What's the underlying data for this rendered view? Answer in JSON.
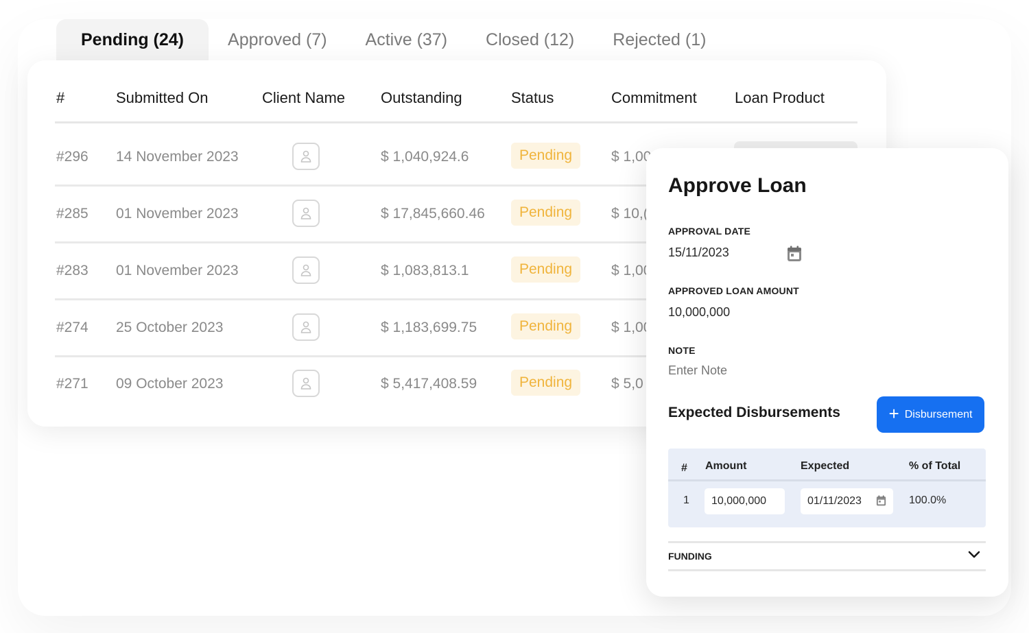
{
  "tabs": [
    {
      "label": "Pending (24)",
      "active": true
    },
    {
      "label": "Approved (7)",
      "active": false
    },
    {
      "label": "Active (37)",
      "active": false
    },
    {
      "label": "Closed (12)",
      "active": false
    },
    {
      "label": "Rejected (1)",
      "active": false
    }
  ],
  "table": {
    "headers": {
      "id": "#",
      "submitted": "Submitted On",
      "client": "Client Name",
      "outstanding": "Outstanding",
      "status": "Status",
      "commitment": "Commitment",
      "product": "Loan Product"
    },
    "rows": [
      {
        "id": "#296",
        "submitted": "14 November 2023",
        "outstanding": "$ 1,040,924.6",
        "status": "Pending",
        "commitment": "$ 1,00"
      },
      {
        "id": "#285",
        "submitted": "01 November 2023",
        "outstanding": "$ 17,845,660.46",
        "status": "Pending",
        "commitment": "$ 10,("
      },
      {
        "id": "#283",
        "submitted": "01 November 2023",
        "outstanding": "$ 1,083,813.1",
        "status": "Pending",
        "commitment": "$ 1,00"
      },
      {
        "id": "#274",
        "submitted": "25 October 2023",
        "outstanding": "$ 1,183,699.75",
        "status": "Pending",
        "commitment": "$ 1,00"
      },
      {
        "id": "#271",
        "submitted": "09 October 2023",
        "outstanding": "$ 5,417,408.59",
        "status": "Pending",
        "commitment": "$ 5,0"
      }
    ]
  },
  "approve_panel": {
    "title": "Approve Loan",
    "approval_date_label": "APPROVAL DATE",
    "approval_date_value": "15/11/2023",
    "amount_label": "APPROVED LOAN AMOUNT",
    "amount_value": "10,000,000",
    "note_label": "NOTE",
    "note_placeholder": "Enter Note",
    "disbursements_title": "Expected Disbursements",
    "add_button_label": "Disbursement",
    "disb_headers": {
      "num": "#",
      "amount": "Amount",
      "expected": "Expected",
      "pct": "% of Total"
    },
    "disb_rows": [
      {
        "num": "1",
        "amount": "10,000,000",
        "expected": "01/11/2023",
        "pct": "100.0%"
      }
    ],
    "funding_label": "FUNDING"
  },
  "colors": {
    "accent": "#1670f1",
    "pending_badge_bg": "#fdf4e1",
    "pending_badge_text": "#f0b43c",
    "disb_box_bg": "#e9eef8"
  },
  "icons": [
    "user-icon",
    "calendar-icon",
    "plus-icon",
    "chevron-down-icon"
  ]
}
